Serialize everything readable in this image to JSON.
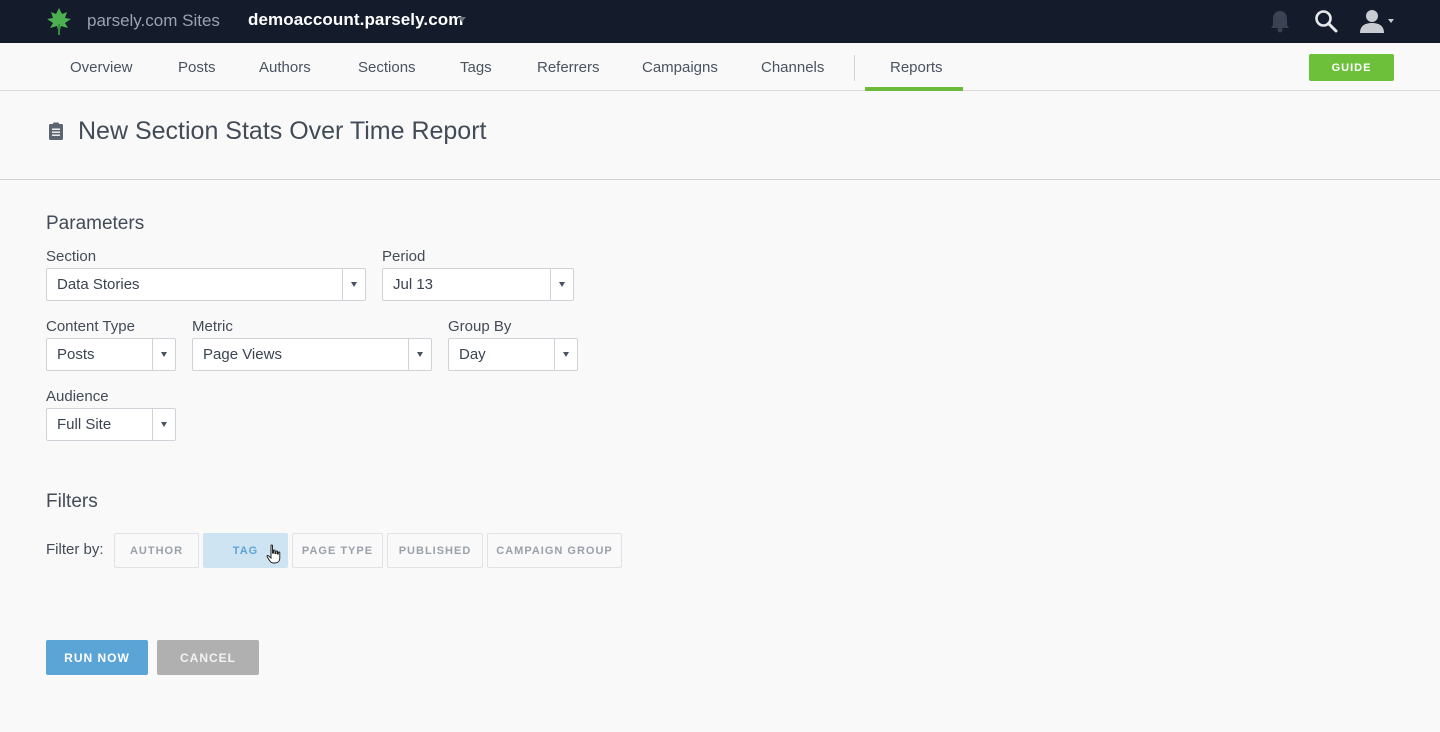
{
  "topbar": {
    "site_label": "parsely.com Sites",
    "account": "demoaccount.parsely.com",
    "icons": [
      "parsely-logo-icon",
      "bell-icon",
      "search-icon",
      "user-icon"
    ]
  },
  "nav": {
    "items": [
      "Overview",
      "Posts",
      "Authors",
      "Sections",
      "Tags",
      "Referrers",
      "Campaigns",
      "Channels",
      "Reports"
    ],
    "active": "Reports",
    "guide_label": "GUIDE"
  },
  "page": {
    "title": "New Section Stats Over Time Report"
  },
  "parameters": {
    "heading": "Parameters",
    "section": {
      "label": "Section",
      "value": "Data Stories"
    },
    "period": {
      "label": "Period",
      "value": "Jul 13"
    },
    "content_type": {
      "label": "Content Type",
      "value": "Posts"
    },
    "metric": {
      "label": "Metric",
      "value": "Page Views"
    },
    "group_by": {
      "label": "Group By",
      "value": "Day"
    },
    "audience": {
      "label": "Audience",
      "value": "Full Site"
    }
  },
  "filters": {
    "heading": "Filters",
    "filter_by_label": "Filter by:",
    "chips": [
      "AUTHOR",
      "TAG",
      "PAGE TYPE",
      "PUBLISHED",
      "CAMPAIGN GROUP"
    ],
    "active_chip": "TAG"
  },
  "actions": {
    "run_label": "RUN NOW",
    "cancel_label": "CANCEL"
  },
  "colors": {
    "topbar": "#141b2b",
    "accent_green": "#6cc03a",
    "accent_blue": "#5ba4d6"
  }
}
